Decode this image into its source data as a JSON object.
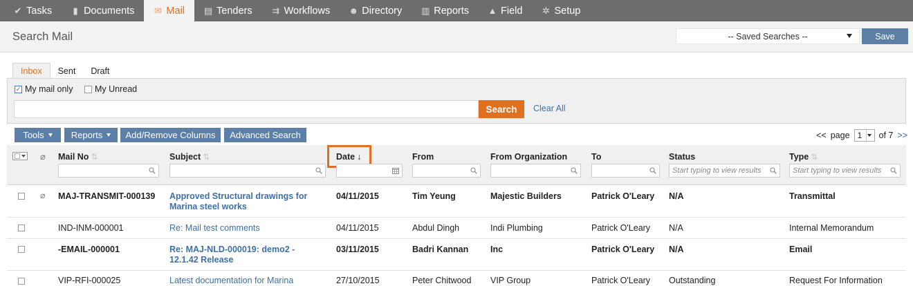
{
  "nav": {
    "items": [
      {
        "label": "Tasks",
        "icon": "check-icon"
      },
      {
        "label": "Documents",
        "icon": "document-icon"
      },
      {
        "label": "Mail",
        "icon": "envelope-icon",
        "active": true
      },
      {
        "label": "Tenders",
        "icon": "tenders-icon"
      },
      {
        "label": "Workflows",
        "icon": "workflow-icon"
      },
      {
        "label": "Directory",
        "icon": "people-icon"
      },
      {
        "label": "Reports",
        "icon": "bar-chart-icon"
      },
      {
        "label": "Field",
        "icon": "warning-icon"
      },
      {
        "label": "Setup",
        "icon": "gear-icon"
      }
    ],
    "active_color": "#e0701f"
  },
  "header": {
    "title": "Search Mail",
    "saved_searches": "-- Saved Searches --",
    "save_label": "Save"
  },
  "tabs": [
    "Inbox",
    "Sent",
    "Draft"
  ],
  "filters": {
    "my_mail_only": "My mail only",
    "my_unread": "My Unread",
    "search_value": "",
    "search_label": "Search",
    "clear_all": "Clear All"
  },
  "toolbar": {
    "tools": "Tools",
    "reports": "Reports",
    "add_remove_columns": "Add/Remove Columns",
    "advanced_search": "Advanced Search"
  },
  "pager": {
    "first": "<<",
    "page_label": "page",
    "current": "1",
    "of_label": "of 7",
    "next": ">>"
  },
  "columns": {
    "mail_no": "Mail No",
    "subject": "Subject",
    "date": "Date",
    "date_sort": "↓",
    "from": "From",
    "from_org": "From Organization",
    "to": "To",
    "status": "Status",
    "type": "Type",
    "filter_placeholder": "Start typing to view results"
  },
  "rows": [
    {
      "mail_no": "MAJ-TRANSMIT-000139",
      "subject_1": "Approved Structural drawings for",
      "subject_2": "Marina steel works",
      "date": "04/11/2015",
      "from": "Tim Yeung",
      "org": "Majestic Builders",
      "to": "Patrick O'Leary",
      "status": "N/A",
      "type": "Transmittal",
      "unread": true,
      "attachment": true
    },
    {
      "mail_no": "IND-INM-000001",
      "subject_1": "Re: Mail test comments",
      "subject_2": "",
      "date": "04/11/2015",
      "from": "Abdul Dingh",
      "org": "Indi Plumbing",
      "to": "Patrick O'Leary",
      "status": "N/A",
      "type": "Internal Memorandum",
      "unread": false,
      "attachment": false
    },
    {
      "mail_no": "-EMAIL-000001",
      "subject_1": "Re: MAJ-NLD-000019: demo2 -",
      "subject_2": "12.1.42 Release",
      "date": "03/11/2015",
      "from": "Badri Kannan",
      "org": "Inc",
      "to": "Patrick O'Leary",
      "status": "N/A",
      "type": "Email",
      "unread": true,
      "attachment": false
    },
    {
      "mail_no": "VIP-RFI-000025",
      "subject_1": "Latest documentation for Marina",
      "subject_2": "",
      "date": "27/10/2015",
      "from": "Peter Chitwood",
      "org": "VIP Group",
      "to": "Patrick O'Leary",
      "status": "Outstanding",
      "type": "Request For Information",
      "unread": false,
      "attachment": false
    }
  ]
}
